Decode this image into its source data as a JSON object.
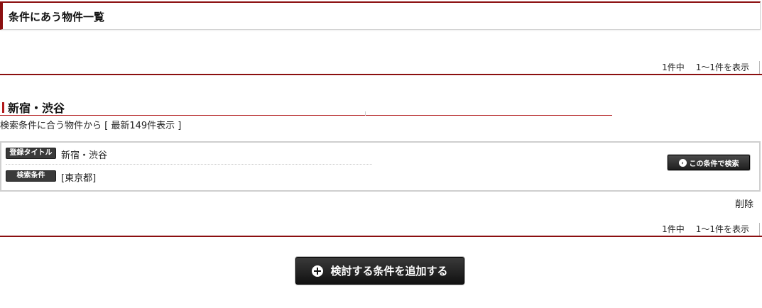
{
  "header": {
    "title": "条件にあう物件一覧"
  },
  "pager_top": {
    "total": "1件中",
    "range": "1〜1件を表示"
  },
  "pager_bottom": {
    "total": "1件中",
    "range": "1〜1件を表示"
  },
  "section": {
    "title": "新宿・渋谷",
    "subtext": "検索条件に合う物件から [ 最新149件表示 ]"
  },
  "condition": {
    "title_tag": "登録タイトル",
    "title_value": "新宿・渋谷",
    "criteria_tag": "検索条件",
    "criteria_value": "[東京都]",
    "search_button": "この条件で検索"
  },
  "delete_label": "削除",
  "add_button": "検討する条件を追加する",
  "colors": {
    "accent": "#8b0f10",
    "button": "#222222"
  }
}
